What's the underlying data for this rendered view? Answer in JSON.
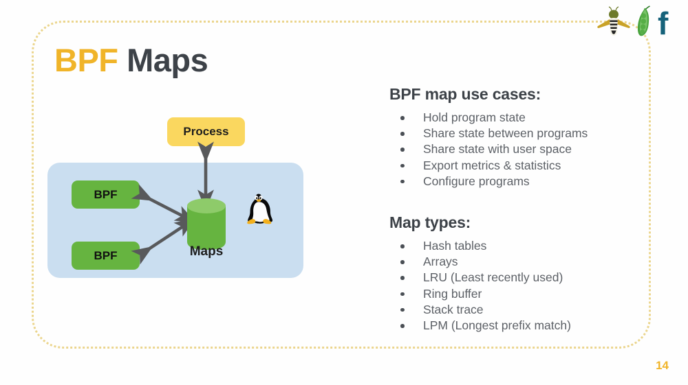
{
  "slide": {
    "title_primary": "BPF",
    "title_secondary": "Maps",
    "page_number": "14",
    "accent_color": "#f0b429",
    "heading_color": "#3d4248",
    "body_text_color": "#5c6066",
    "frame_border_color": "#e8cf7a",
    "background_color": "#fefefe"
  },
  "logo": {
    "bee_icon_name": "bee-icon",
    "pea_pod_icon_name": "pea-pod-icon",
    "letter": "f",
    "bee_wing_color": "#c9a227",
    "bee_head_color": "#6d7a2a",
    "pea_color": "#4aa23c",
    "letter_color": "#16627a"
  },
  "use_cases": {
    "heading": "BPF map use cases:",
    "items": [
      "Hold program state",
      "Share state between programs",
      "Share state with user space",
      "Export metrics & statistics",
      "Configure programs"
    ]
  },
  "map_types": {
    "heading": "Map types:",
    "items": [
      "Hash tables",
      "Arrays",
      "LRU (Least recently used)",
      "Ring buffer",
      "Stack trace",
      "LPM (Longest prefix match)"
    ]
  },
  "diagram": {
    "process_label": "Process",
    "bpf_label_1": "BPF",
    "bpf_label_2": "BPF",
    "maps_label": "Maps",
    "kernel_box_color": "#cadef0",
    "bpf_box_color": "#66b440",
    "process_box_color": "#fad75f",
    "cylinder_body_color": "#66b440",
    "cylinder_top_color": "#8ecb6a",
    "arrow_color": "#58595b",
    "tux_icon_name": "linux-tux-penguin-icon"
  }
}
